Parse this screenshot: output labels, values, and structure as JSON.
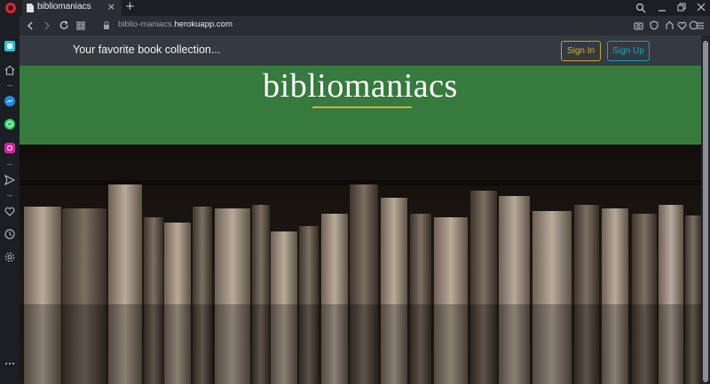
{
  "browser": {
    "tab_title": "bibliomaniacs",
    "url_prefix": "biblio-maniacs.",
    "url_domain": "herokuapp.com",
    "new_tab": "+",
    "tab_close": "×"
  },
  "site": {
    "tagline": "Your favorite book collection...",
    "signin_label": "Sign In",
    "signup_label": "Sign Up",
    "hero_title": "bibliomaniacs"
  },
  "colors": {
    "hero_green": "#367a3e",
    "navbar": "#343a40",
    "signin_gold": "#c9a227",
    "signup_teal": "#17a2b8"
  }
}
